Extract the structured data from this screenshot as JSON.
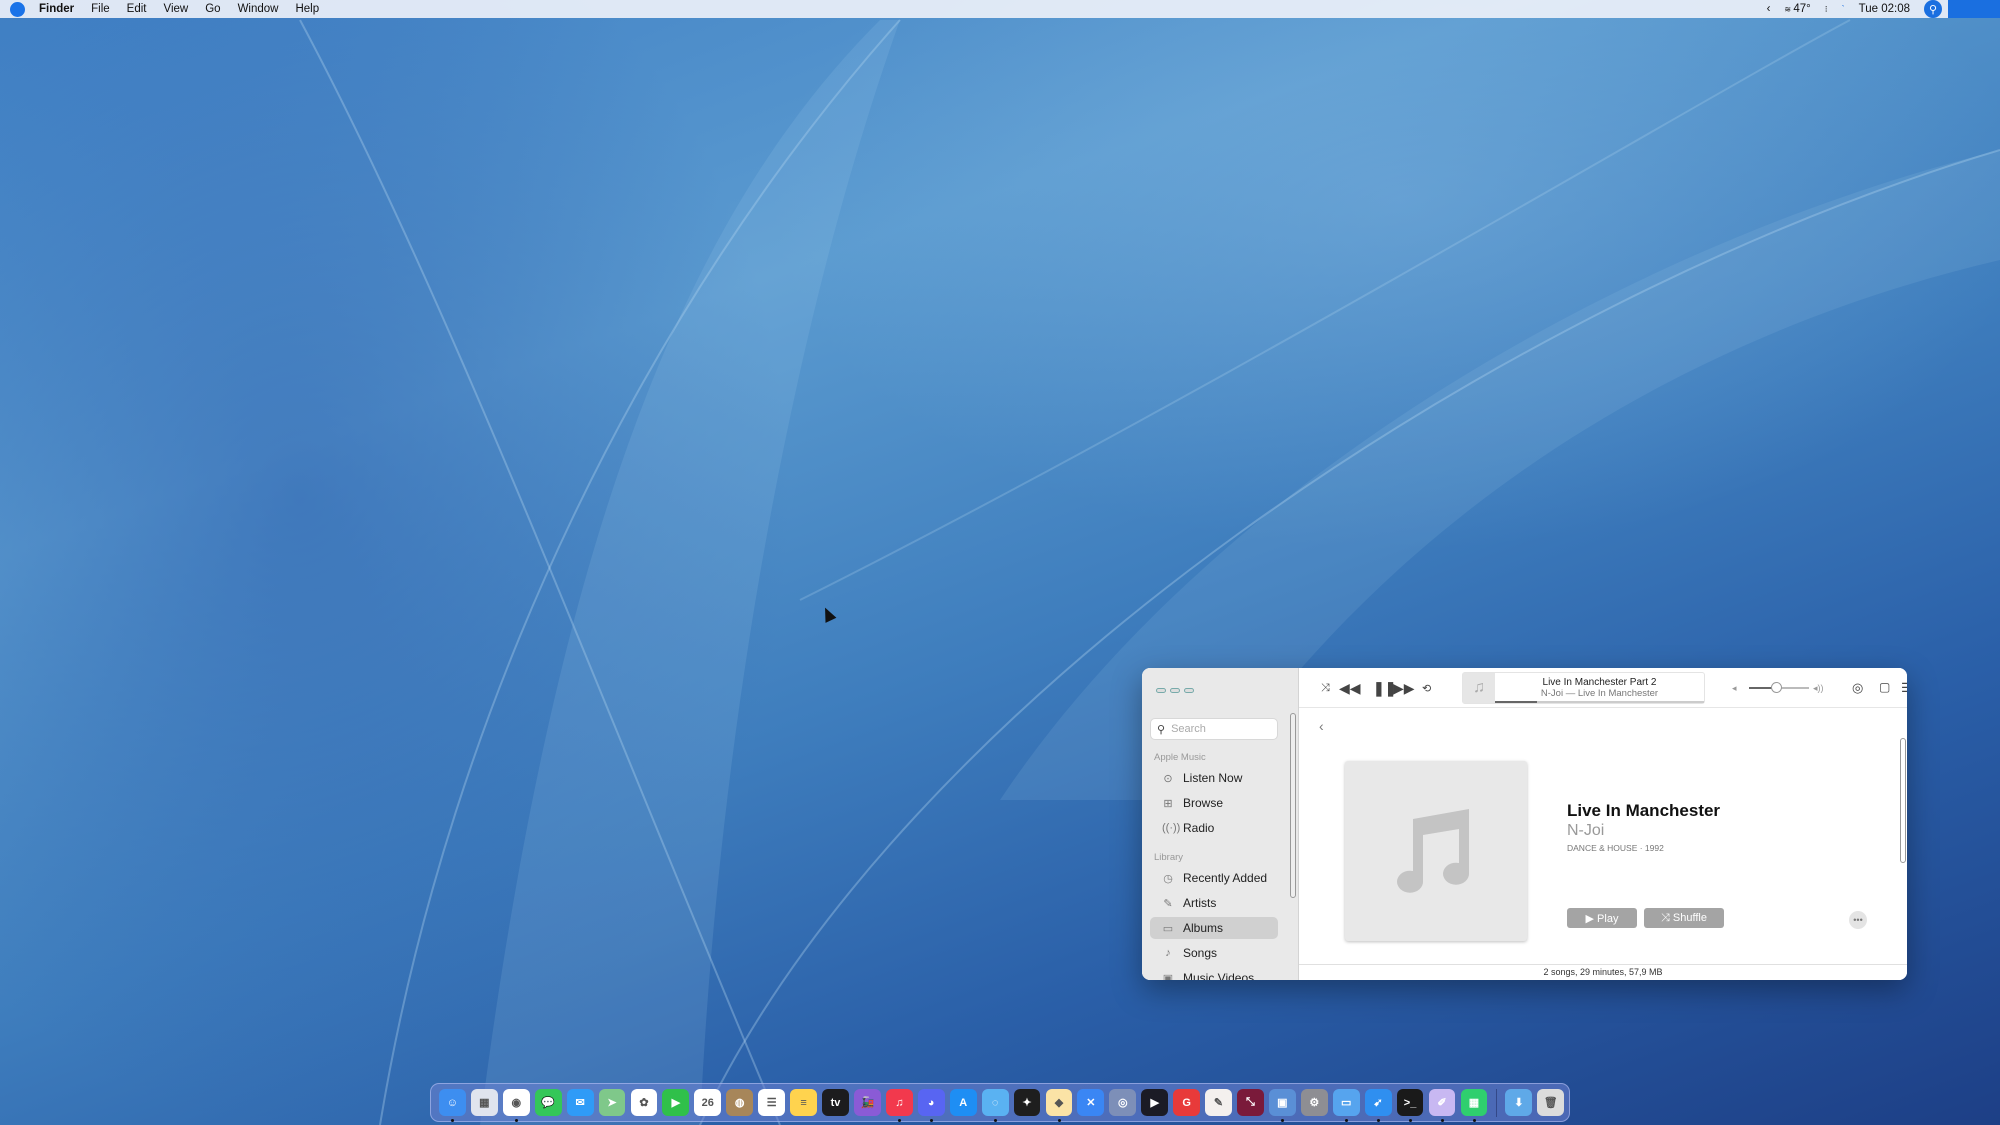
{
  "menubar": {
    "app": "Finder",
    "items": [
      "File",
      "Edit",
      "View",
      "Go",
      "Window",
      "Help"
    ],
    "status": {
      "weather": "47°",
      "clock": "Tue 02:08"
    }
  },
  "music": {
    "search_placeholder": "Search",
    "sections": {
      "apple_music": "Apple Music",
      "library": "Library"
    },
    "nav": [
      {
        "label": "Listen Now",
        "icon": "play-circle-icon"
      },
      {
        "label": "Browse",
        "icon": "grid-icon"
      },
      {
        "label": "Radio",
        "icon": "broadcast-icon"
      },
      {
        "label": "Recently Added",
        "icon": "clock-icon"
      },
      {
        "label": "Artists",
        "icon": "microphone-icon"
      },
      {
        "label": "Albums",
        "icon": "album-icon",
        "selected": true
      },
      {
        "label": "Songs",
        "icon": "note-icon"
      },
      {
        "label": "Music Videos",
        "icon": "video-icon"
      }
    ],
    "now_playing": {
      "track": "Live In Manchester Part 2",
      "subtitle": "N-Joi — Live In Manchester",
      "progress": 0.2,
      "volume": 0.45,
      "state": "playing"
    },
    "album": {
      "title": "Live In Manchester",
      "artist": "N-Joi",
      "meta": "DANCE & HOUSE · 1992",
      "play_label": "▶ Play",
      "shuffle_label": "⤨ Shuffle",
      "more_label": "•••"
    },
    "status": "2 songs, 29 minutes, 57,9 MB"
  },
  "dock": {
    "apps": [
      {
        "name": "Finder",
        "color": "#3d8ef0",
        "glyph": "☺",
        "running": true
      },
      {
        "name": "Launchpad",
        "color": "#e0e4ee",
        "glyph": "▦",
        "running": false
      },
      {
        "name": "Chrome",
        "color": "#ffffff",
        "glyph": "◉",
        "running": true
      },
      {
        "name": "Messages",
        "color": "#34c759",
        "glyph": "💬",
        "running": false
      },
      {
        "name": "Mail",
        "color": "#2f9bf7",
        "glyph": "✉",
        "running": false
      },
      {
        "name": "Maps",
        "color": "#7fc88a",
        "glyph": "➤",
        "running": false
      },
      {
        "name": "Photos",
        "color": "#ffffff",
        "glyph": "✿",
        "running": false
      },
      {
        "name": "FaceTime",
        "color": "#30c04a",
        "glyph": "▶",
        "running": false
      },
      {
        "name": "Calendar",
        "color": "#ffffff",
        "glyph": "26",
        "running": false
      },
      {
        "name": "Contacts",
        "color": "#a7865a",
        "glyph": "◍",
        "running": false
      },
      {
        "name": "Reminders",
        "color": "#ffffff",
        "glyph": "☰",
        "running": false
      },
      {
        "name": "Notes",
        "color": "#ffd34e",
        "glyph": "≡",
        "running": false
      },
      {
        "name": "Apple TV",
        "color": "#1c1c1e",
        "glyph": "tv",
        "running": false
      },
      {
        "name": "Train App",
        "color": "#8a5bd6",
        "glyph": "🚂",
        "running": false
      },
      {
        "name": "Music",
        "color": "#f2394d",
        "glyph": "♫",
        "running": true
      },
      {
        "name": "Discord",
        "color": "#5865f2",
        "glyph": "◕",
        "running": true
      },
      {
        "name": "App Store",
        "color": "#1e8ef4",
        "glyph": "A",
        "running": false
      },
      {
        "name": "Loader App",
        "color": "#5ab2f2",
        "glyph": "◌",
        "running": true
      },
      {
        "name": "Figma",
        "color": "#1e1e1e",
        "glyph": "✦",
        "running": false
      },
      {
        "name": "Sketch",
        "color": "#fbe3a6",
        "glyph": "◆",
        "running": true
      },
      {
        "name": "Xcode Tools",
        "color": "#3a86f4",
        "glyph": "✕",
        "running": false
      },
      {
        "name": "Vinyl App",
        "color": "#7d8fb8",
        "glyph": "◎",
        "running": false
      },
      {
        "name": "Infuse",
        "color": "#1b1b25",
        "glyph": "▶",
        "running": false
      },
      {
        "name": "Red App",
        "color": "#e83a3a",
        "glyph": "G",
        "running": false
      },
      {
        "name": "Pixelmator",
        "color": "#f4f0ee",
        "glyph": "✎",
        "running": false
      },
      {
        "name": "Remote Desktop",
        "color": "#7a1a3a",
        "glyph": "⤡",
        "running": false
      },
      {
        "name": "Preview",
        "color": "#5a8fd6",
        "glyph": "▣",
        "running": true
      },
      {
        "name": "System Preferences",
        "color": "#8e8e93",
        "glyph": "⚙",
        "running": false
      },
      {
        "name": "Simulator",
        "color": "#56a4ee",
        "glyph": "▭",
        "running": true
      },
      {
        "name": "Safari",
        "color": "#2f8ff0",
        "glyph": "➹",
        "running": true
      },
      {
        "name": "Terminal",
        "color": "#1a1a1a",
        "glyph": ">_",
        "running": true
      },
      {
        "name": "Design App",
        "color": "#c8b8f2",
        "glyph": "✐",
        "running": true
      },
      {
        "name": "Color Grid",
        "color": "#2fcf6e",
        "glyph": "▦",
        "running": true
      }
    ],
    "downloads": {
      "name": "Downloads",
      "color": "#5fa9e8",
      "glyph": "⬇"
    },
    "trash": {
      "name": "Trash",
      "color": "#dcdcdc",
      "glyph": "🗑"
    }
  }
}
